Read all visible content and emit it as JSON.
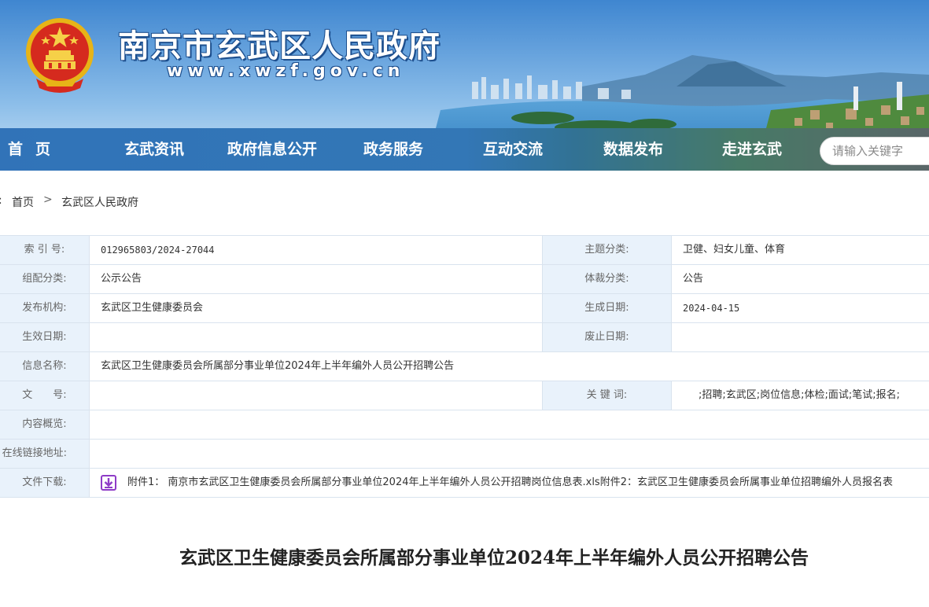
{
  "header": {
    "site_title": "南京市玄武区人民政府",
    "site_url": "www.xwzf.gov.cn",
    "emblem_icon": "national-emblem-icon"
  },
  "nav": {
    "items": [
      "首页",
      "玄武资讯",
      "政府信息公开",
      "政务服务",
      "互动交流",
      "数据发布",
      "走进玄武"
    ],
    "search_placeholder": "请输入关键字"
  },
  "breadcrumb": {
    "prefix": ":",
    "home": "首页",
    "separator": ">",
    "current": "玄武区人民政府"
  },
  "info": {
    "index_no_label": "索 引 号:",
    "index_no": "012965803/2024-27044",
    "topic_label": "主题分类:",
    "topic": "卫健、妇女儿童、体育",
    "category_label": "组配分类:",
    "category": "公示公告",
    "genre_label": "体裁分类:",
    "genre": "公告",
    "publisher_label": "发布机构:",
    "publisher": "玄武区卫生健康委员会",
    "created_label": "生成日期:",
    "created": "2024-04-15",
    "effective_label": "生效日期:",
    "effective": "",
    "abolished_label": "废止日期:",
    "abolished": "",
    "name_label": "信息名称:",
    "name": "玄武区卫生健康委员会所属部分事业单位2024年上半年编外人员公开招聘公告",
    "doc_no_label": "文　　号:",
    "doc_no": "",
    "keywords_label": "关 键 词:",
    "keywords": ";招聘;玄武区;岗位信息;体检;面试;笔试;报名;",
    "summary_label": "内容概览:",
    "summary": "",
    "link_label": "在线链接地址:",
    "link": "",
    "download_label": "文件下载:",
    "download": "附件1： 南京市玄武区卫生健康委员会所属部分事业单位2024年上半年编外人员公开招聘岗位信息表.xls附件2：玄武区卫生健康委员会所属事业单位招聘编外人员报名表"
  },
  "article": {
    "title": "玄武区卫生健康委员会所属部分事业单位2024年上半年编外人员公开招聘公告"
  },
  "colors": {
    "nav_bg": "#3f83c4",
    "label_bg": "#e9f2fb",
    "border": "#d9e3ee",
    "download_icon": "#8e3bc7"
  }
}
